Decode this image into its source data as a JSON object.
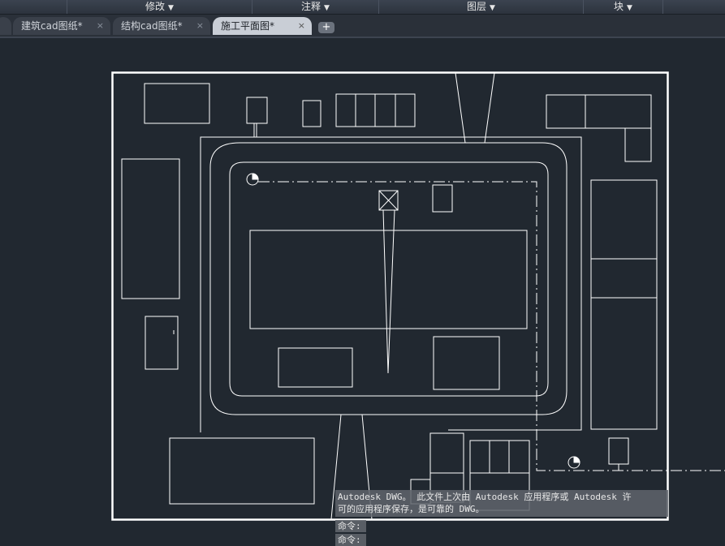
{
  "ribbon": {
    "panels": [
      {
        "label": "修改"
      },
      {
        "label": "注释"
      },
      {
        "label": "图层"
      },
      {
        "label": "块"
      }
    ]
  },
  "tabs": [
    {
      "label": "建筑cad图纸*",
      "active": false
    },
    {
      "label": "结构cad图纸*",
      "active": false
    },
    {
      "label": "施工平面图*",
      "active": true
    }
  ],
  "icons": {
    "close": "×",
    "add_tab": "+",
    "caret": "▼"
  },
  "command": {
    "history_line1": "Autodesk DWG。  此文件上次由 Autodesk 应用程序或 Autodesk 许",
    "history_line2": "可的应用程序保存，是可靠的 DWG。",
    "prompt1": "命令:",
    "prompt2": "命令:"
  },
  "colors": {
    "background": "#212830",
    "drawing_line": "#ffffff"
  }
}
